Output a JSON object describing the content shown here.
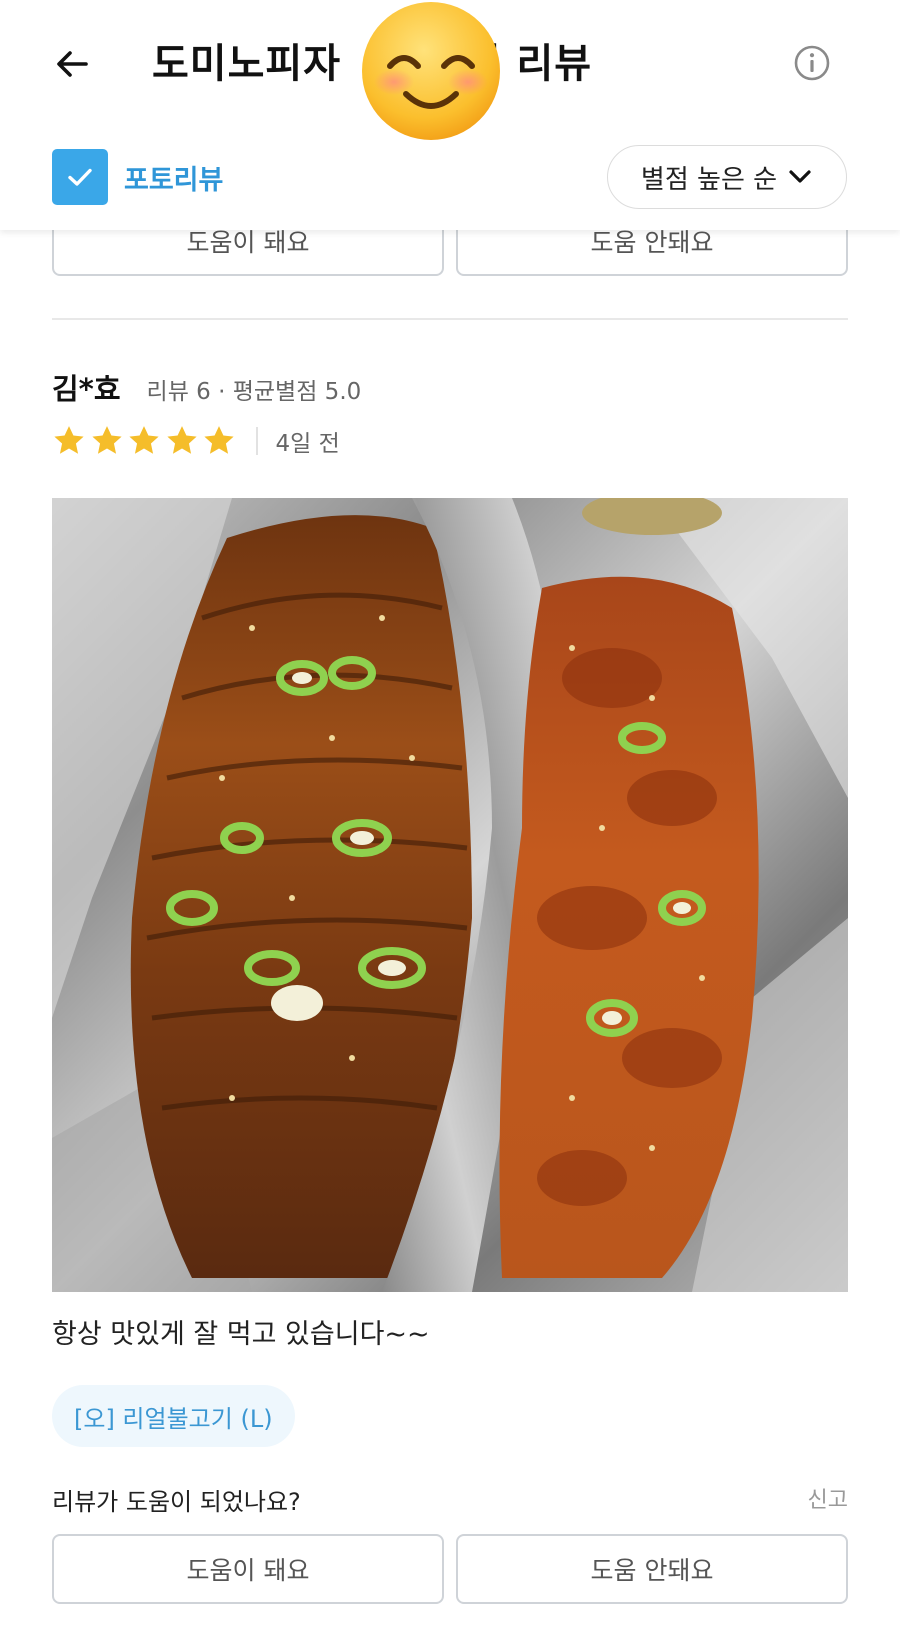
{
  "header": {
    "title": "도미노피자 ",
    "title_tail": "별점 리뷰",
    "back_icon": "arrow-left-icon",
    "info_icon": "info-icon",
    "obscuring_emoji": "smiling-face-emoji"
  },
  "filters": {
    "photo_review_label": "포토리뷰",
    "photo_review_checked": true,
    "sort_label": "별점 높은 순"
  },
  "feedback_top": {
    "helpful_label": "도움이 돼요",
    "not_helpful_label": "도움 안돼요"
  },
  "review": {
    "reviewer_name": "김*효",
    "reviewer_meta": "리뷰 6 · 평균별점 5.0",
    "rating": 5,
    "date": "4일 전",
    "text": "항상 맛있게 잘 먹고 있습니다~~",
    "menu_tag": "[오] 리얼불고기 (L)",
    "helpful_question": "리뷰가 도움이 되었나요?",
    "report_label": "신고",
    "helpful_label": "도움이 돼요",
    "not_helpful_label": "도움 안돼요"
  },
  "colors": {
    "accent": "#3aa7e8",
    "star": "#f5bd2a",
    "tag_bg": "#eef7fd"
  }
}
